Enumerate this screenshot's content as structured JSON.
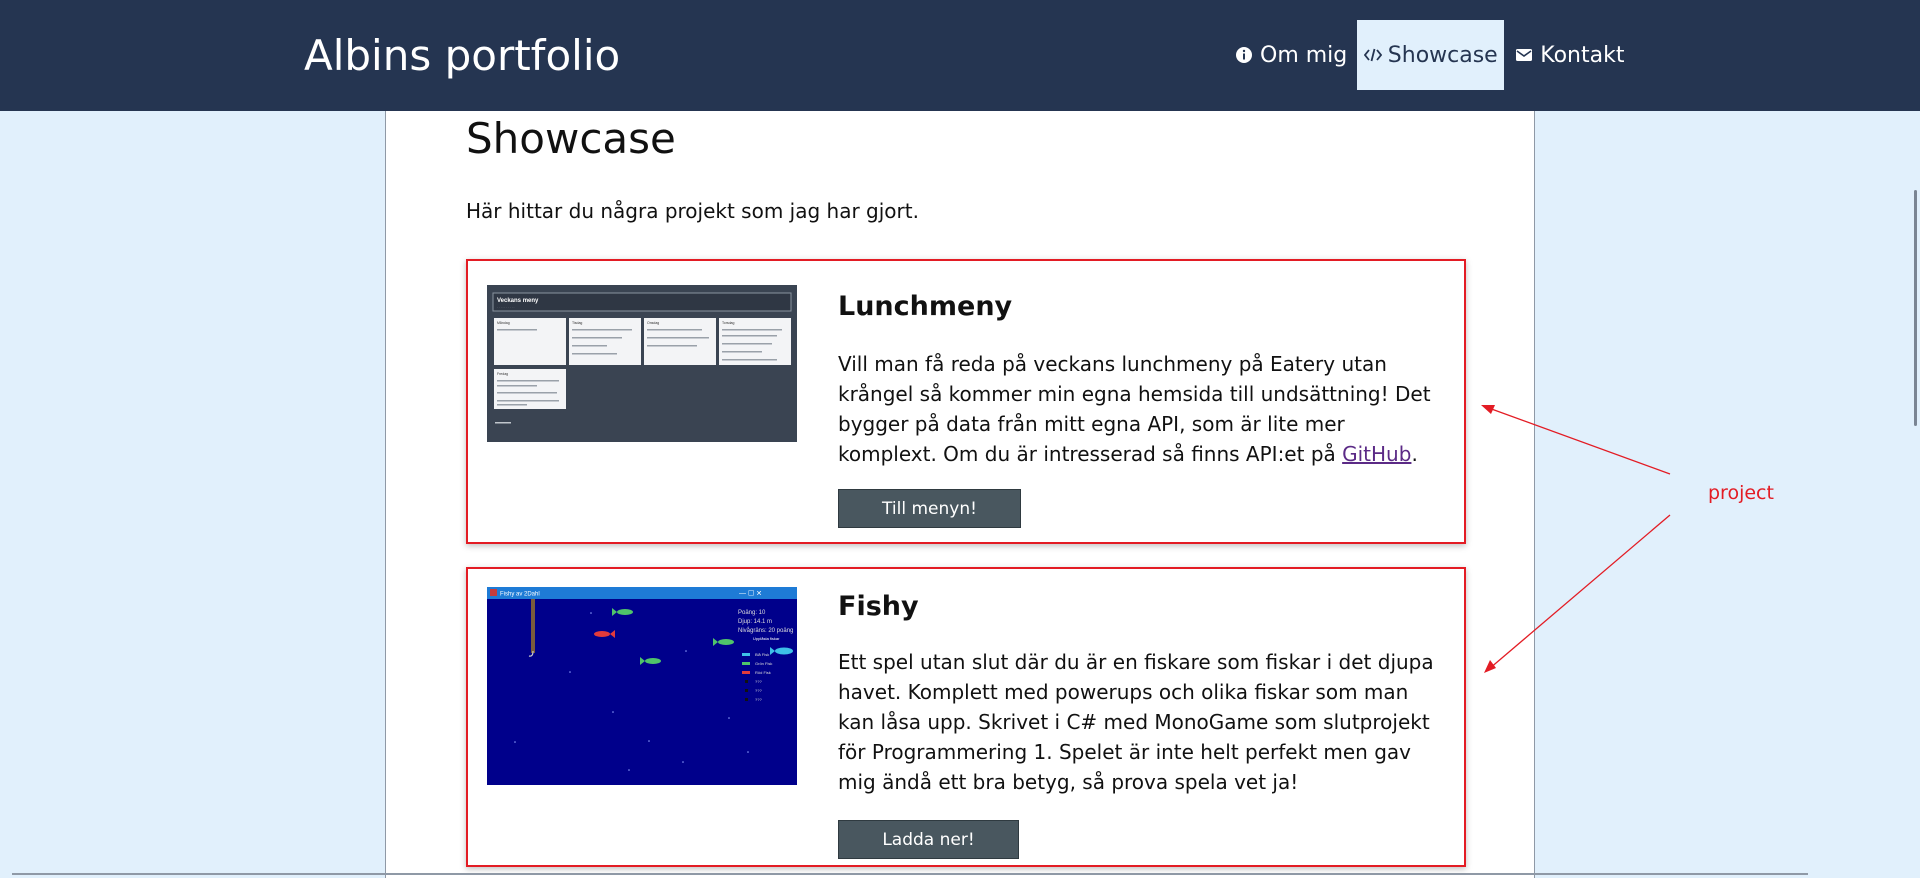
{
  "header": {
    "site_title": "Albins portfolio",
    "nav": [
      {
        "label": "Om mig",
        "icon": "info-icon",
        "active": false
      },
      {
        "label": "Showcase",
        "icon": "code-icon",
        "active": true
      },
      {
        "label": "Kontakt",
        "icon": "mail-icon",
        "active": false
      }
    ]
  },
  "main": {
    "title": "Showcase",
    "intro": "Här hittar du några projekt som jag har gjort.",
    "projects": [
      {
        "title": "Lunchmeny",
        "description": "Vill man få reda på veckans lunchmeny på Eatery utan krångel så kommer min egna hemsida till undsättning! Det bygger på data från mitt egna API, som är lite mer komplext. Om du är intresserad så finns API:et på ",
        "link_text": "GitHub",
        "description_end": ".",
        "button_label": "Till menyn!",
        "thumbnail": {
          "title": "Veckans meny",
          "days": [
            "Måndag",
            "Tisdag",
            "Onsdag",
            "Torsdag",
            "Fredag"
          ]
        }
      },
      {
        "title": "Fishy",
        "description": "Ett spel utan slut där du är en fiskare som fiskar i det djupa havet. Komplett med powerups och olika fiskar som man kan låsa upp. Skrivet i C# med MonoGame som slutprojekt för Programmering 1. Spelet är inte helt perfekt men gav mig ändå ett bra betyg, så prova spela vet ja!",
        "button_label": "Ladda ner!",
        "thumbnail": {
          "window_title": "Fishy av 2Dahl",
          "score": "Poäng: 10",
          "depth": "Djup: 14.1 m",
          "level": "Nivågräns: 20 poäng",
          "fish_list_title": "Upplåsta fiskar",
          "fish_list": [
            "Blå Fisk",
            "Grön Fisk",
            "Röd Fisk",
            "???",
            "???",
            "???"
          ]
        }
      }
    ]
  },
  "annotation": {
    "label": "project",
    "color": "#e31c24"
  },
  "colors": {
    "header_bg": "#253551",
    "page_bg": "#e1f0fc",
    "button_bg": "#49575f",
    "link": "#5b2a86"
  }
}
